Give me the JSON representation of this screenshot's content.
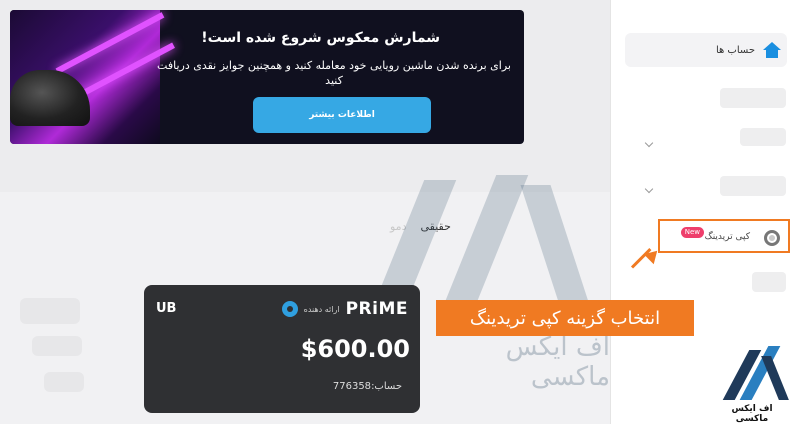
{
  "banner": {
    "title": "شمارش معکوس شروع شده است!",
    "text": "برای برنده شدن ماشین رویایی خود معامله کنید و همچنین جوایز نقدی دریافت کنید",
    "button_label": "اطلاعات بیشتر"
  },
  "tabs": [
    {
      "label": "حقیقی"
    },
    {
      "label": "دمو"
    }
  ],
  "account_card": {
    "logo": "UB",
    "brand": "PRiME",
    "provider": "ارائه دهنده",
    "amount": "$600.00",
    "account_label": "حساب:",
    "account_number": "776358"
  },
  "sidebar": {
    "accounts_label": "حساب ها",
    "copy_trading_label": "کپی تریدینگ",
    "copy_trading_badge": "New"
  },
  "annotation": {
    "callout": "انتخاب گزینه کپی تریدینگ",
    "watermark": "اف ایکس ماکسی"
  },
  "brand": {
    "name": "اف ایکس ماکسی"
  },
  "colors": {
    "accent_orange": "#f07a22",
    "button_blue": "#36a8e4",
    "card_bg": "#2f3033",
    "badge_pink": "#ee3e6b"
  },
  "icons": [
    "home-icon",
    "copy-trading-icon",
    "chevron-down-icon",
    "arrow-icon"
  ]
}
